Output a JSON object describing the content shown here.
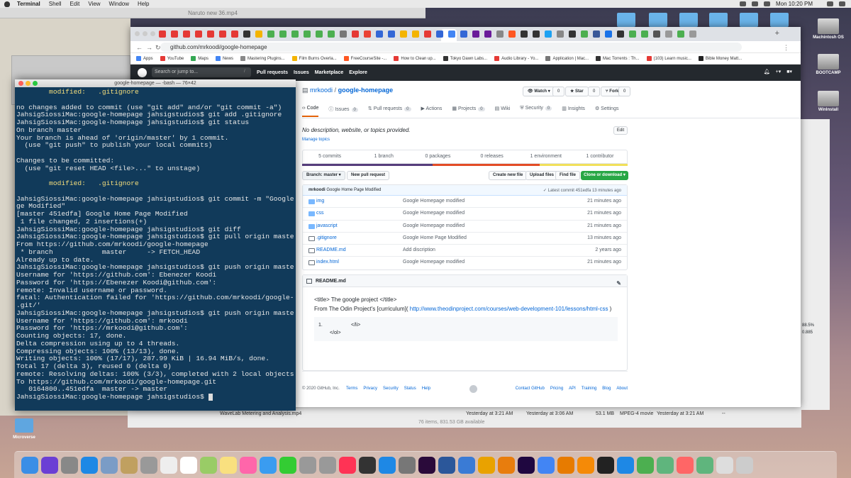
{
  "menubar": {
    "app": "Terminal",
    "items": [
      "Shell",
      "Edit",
      "View",
      "Window",
      "Help"
    ],
    "clock": "Mon 10:20 PM"
  },
  "background": {
    "video_title": "Naruto new 36.mp4",
    "finder_file": "WaveLab Metering and Analysis.mp4",
    "finder_date1": "Yesterday at 3:21 AM",
    "finder_date2": "Yesterday at 3:06 AM",
    "finder_size": "53.1 MB",
    "finder_kind": "MPEG-4 movie",
    "finder_date3": "Yesterday at 3:21 AM",
    "finder_dash": "--",
    "finder_status": "76 items, 831.53 GB available",
    "right_panel": [
      "88.5%",
      "0.885"
    ]
  },
  "desktop_icons": [
    {
      "label": "Machintosh OS"
    },
    {
      "label": "BOOTCAMP"
    },
    {
      "label": "WinInstall"
    },
    {
      "label": "Microverse"
    }
  ],
  "chrome": {
    "url": "github.com/mrkoodi/google-homepage",
    "bookmarks": [
      "Apps",
      "YouTube",
      "Maps",
      "News",
      "Mastering Plugins...",
      "Film Burns Overla...",
      "FreeCourseSite -...",
      "How to Clean up...",
      "Tokyo Dawn Labs...",
      "Audio Library - Yo...",
      "Application | Mac...",
      "Mac Torrents : Th...",
      "(103) Learn music...",
      "Bible Money Matt..."
    ]
  },
  "github": {
    "search_placeholder": "Search or jump to...",
    "search_key": "/",
    "nav": [
      "Pull requests",
      "Issues",
      "Marketplace",
      "Explore"
    ],
    "owner": "mrkoodi",
    "separator": "/",
    "repo": "google-homepage",
    "watch": {
      "label": "Watch ▾",
      "count": "0"
    },
    "star": {
      "label": "Star",
      "count": "0"
    },
    "fork": {
      "label": "Fork",
      "count": "0"
    },
    "tabs": [
      {
        "label": "Code",
        "count": ""
      },
      {
        "label": "Issues",
        "count": "0"
      },
      {
        "label": "Pull requests",
        "count": "0"
      },
      {
        "label": "Actions",
        "count": ""
      },
      {
        "label": "Projects",
        "count": "0"
      },
      {
        "label": "Wiki",
        "count": ""
      },
      {
        "label": "Security",
        "count": "0"
      },
      {
        "label": "Insights",
        "count": ""
      },
      {
        "label": "Settings",
        "count": ""
      }
    ],
    "description": "No description, website, or topics provided.",
    "edit": "Edit",
    "manage_topics": "Manage topics",
    "stats": [
      "5 commits",
      "1 branch",
      "0 packages",
      "0 releases",
      "1 environment",
      "1 contributor"
    ],
    "branch": "Branch: master ▾",
    "new_pr": "New pull request",
    "create_file": "Create new file",
    "upload": "Upload files",
    "find": "Find file",
    "clone": "Clone or download ▾",
    "commit_user": "mrkoodi",
    "commit_msg": "Google Home Page Modified",
    "latest_commit": "✓ Latest commit 451edfa 13 minutes ago",
    "files": [
      {
        "name": "img",
        "msg": "Google Homepage modified",
        "time": "21 minutes ago",
        "type": "dir"
      },
      {
        "name": "css",
        "msg": "Google Homepage modified",
        "time": "21 minutes ago",
        "type": "dir"
      },
      {
        "name": "javascript",
        "msg": "Google Homepage modified",
        "time": "21 minutes ago",
        "type": "dir"
      },
      {
        "name": ".gitignore",
        "msg": "Google Home Page Modified",
        "time": "13 minutes ago",
        "type": "file"
      },
      {
        "name": "README.md",
        "msg": "Add discription",
        "time": "2 years ago",
        "type": "file"
      },
      {
        "name": "index.html",
        "msg": "Google Homepage modified",
        "time": "21 minutes ago",
        "type": "file"
      }
    ],
    "readme_title": "README.md",
    "readme_line1": "<title> The google project </title>",
    "readme_line2_pre": "From The Odin Project's [curriculum](",
    "readme_link": "http://www.theodinproject.com/courses/web-development-101/lessons/html-css",
    "readme_line2_post": " )",
    "code_num": "1.",
    "code_line1": "</li>",
    "code_line2": "</ol>",
    "footer_copy": "© 2020 GitHub, Inc.",
    "footer_links": [
      "Terms",
      "Privacy",
      "Security",
      "Status",
      "Help"
    ],
    "footer_links2": [
      "Contact GitHub",
      "Pricing",
      "API",
      "Training",
      "Blog",
      "About"
    ]
  },
  "terminal": {
    "title": "google-homepage — -bash — 76×42",
    "lines": [
      {
        "t": "        modified:   .gitignore",
        "hl": true
      },
      {
        "t": "",
        "hl": false
      },
      {
        "t": "no changes added to commit (use \"git add\" and/or \"git commit -a\")",
        "hl": false
      },
      {
        "t": "JahsigSiossiMac:google-homepage jahsigstudios$ git add .gitignore",
        "hl": false
      },
      {
        "t": "JahsigSiossiMac:google-homepage jahsigstudios$ git status",
        "hl": false
      },
      {
        "t": "On branch master",
        "hl": false
      },
      {
        "t": "Your branch is ahead of 'origin/master' by 1 commit.",
        "hl": false
      },
      {
        "t": "  (use \"git push\" to publish your local commits)",
        "hl": false
      },
      {
        "t": "",
        "hl": false
      },
      {
        "t": "Changes to be committed:",
        "hl": false
      },
      {
        "t": "  (use \"git reset HEAD <file>...\" to unstage)",
        "hl": false
      },
      {
        "t": "",
        "hl": false
      },
      {
        "t": "        modified:   .gitignore",
        "hl": true
      },
      {
        "t": "",
        "hl": false
      },
      {
        "t": "JahsigSiossiMac:google-homepage jahsigstudios$ git commit -m \"Google Home Pa",
        "hl": false
      },
      {
        "t": "ge Modified\"",
        "hl": false
      },
      {
        "t": "[master 451edfa] Google Home Page Modified",
        "hl": false
      },
      {
        "t": " 1 file changed, 2 insertions(+)",
        "hl": false
      },
      {
        "t": "JahsigSiossiMac:google-homepage jahsigstudios$ git diff",
        "hl": false
      },
      {
        "t": "JahsigSiossiMac:google-homepage jahsigstudios$ git pull origin master",
        "hl": false
      },
      {
        "t": "From https://github.com/mrkoodi/google-homepage",
        "hl": false
      },
      {
        "t": " * branch            master     -> FETCH_HEAD",
        "hl": false
      },
      {
        "t": "Already up to date.",
        "hl": false
      },
      {
        "t": "JahsigSiossiMac:google-homepage jahsigstudios$ git push origin master",
        "hl": false
      },
      {
        "t": "Username for 'https://github.com': Ebenezer Koodi",
        "hl": false
      },
      {
        "t": "Password for 'https://Ebenezer Koodi@github.com':",
        "hl": false
      },
      {
        "t": "remote: Invalid username or password.",
        "hl": false
      },
      {
        "t": "fatal: Authentication failed for 'https://github.com/mrkoodi/google-homepage",
        "hl": false
      },
      {
        "t": ".git/'",
        "hl": false
      },
      {
        "t": "JahsigSiossiMac:google-homepage jahsigstudios$ git push origin master",
        "hl": false
      },
      {
        "t": "Username for 'https://github.com': mrkoodi",
        "hl": false
      },
      {
        "t": "Password for 'https://mrkoodi@github.com':",
        "hl": false
      },
      {
        "t": "Counting objects: 17, done.",
        "hl": false
      },
      {
        "t": "Delta compression using up to 4 threads.",
        "hl": false
      },
      {
        "t": "Compressing objects: 100% (13/13), done.",
        "hl": false
      },
      {
        "t": "Writing objects: 100% (17/17), 287.99 KiB | 16.94 MiB/s, done.",
        "hl": false
      },
      {
        "t": "Total 17 (delta 3), reused 0 (delta 0)",
        "hl": false
      },
      {
        "t": "remote: Resolving deltas: 100% (3/3), completed with 2 local objects.",
        "hl": false
      },
      {
        "t": "To https://github.com/mrkoodi/google-homepage.git",
        "hl": false
      },
      {
        "t": "   0164800..451edfa  master -> master",
        "hl": false
      }
    ],
    "prompt": "JahsigSiossiMac:google-homepage jahsigstudios$ "
  },
  "colors": {
    "terminal_bg": "#113a5a",
    "github_header": "#24292e",
    "link": "#0366d6",
    "clone_green": "#28a745",
    "highlight_yellow": "#f6df7c"
  }
}
